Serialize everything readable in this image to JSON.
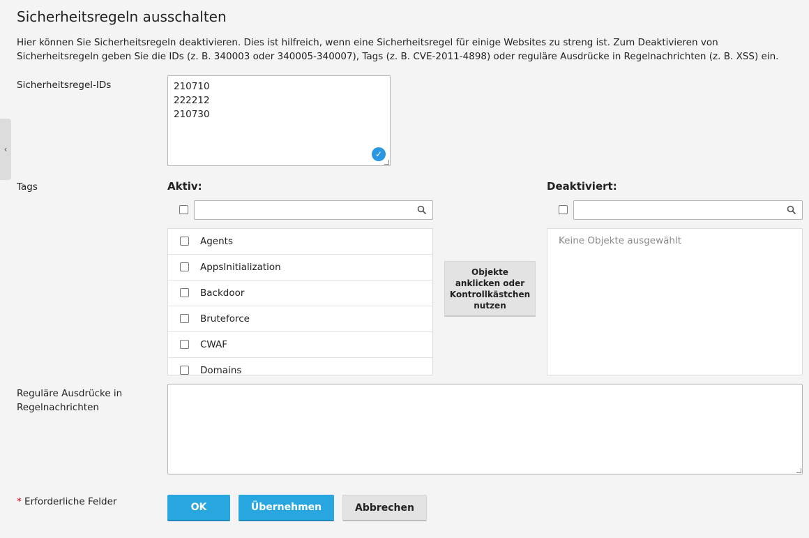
{
  "page": {
    "title": "Sicherheitsregeln ausschalten",
    "description": "Hier können Sie Sicherheitsregeln deaktivieren. Dies ist hilfreich, wenn eine Sicherheitsregel für einige Websites zu streng ist. Zum Deaktivieren von Sicherheitsregeln geben Sie die IDs (z. B. 340003 oder 340005-340007), Tags (z. B. CVE-2011-4898) oder reguläre Ausdrücke in Regelnachrichten (z. B. XSS) ein."
  },
  "ids": {
    "label": "Sicherheitsregel-IDs",
    "values": [
      "210710",
      "222212",
      "210730"
    ]
  },
  "tags": {
    "label": "Tags",
    "active_heading": "Aktiv:",
    "inactive_heading": "Deaktiviert:",
    "active_items": [
      "Agents",
      "AppsInitialization",
      "Backdoor",
      "Bruteforce",
      "CWAF",
      "Domains"
    ],
    "move_button": "Objekte anklicken oder Kontrollkästchen nutzen",
    "empty_text": "Keine Objekte ausgewählt"
  },
  "regex": {
    "label": "Reguläre Ausdrücke in Regelnachrichten"
  },
  "footer": {
    "required_star": "*",
    "required_label": "Erforderliche Felder",
    "ok": "OK",
    "apply": "Übernehmen",
    "cancel": "Abbrechen"
  },
  "colors": {
    "primary": "#28a6df",
    "check": "#2a97e3",
    "required": "#d0021b"
  },
  "icons": {
    "collapse": "chevron-left-icon",
    "search": "search-icon",
    "valid": "check-circle-icon"
  }
}
